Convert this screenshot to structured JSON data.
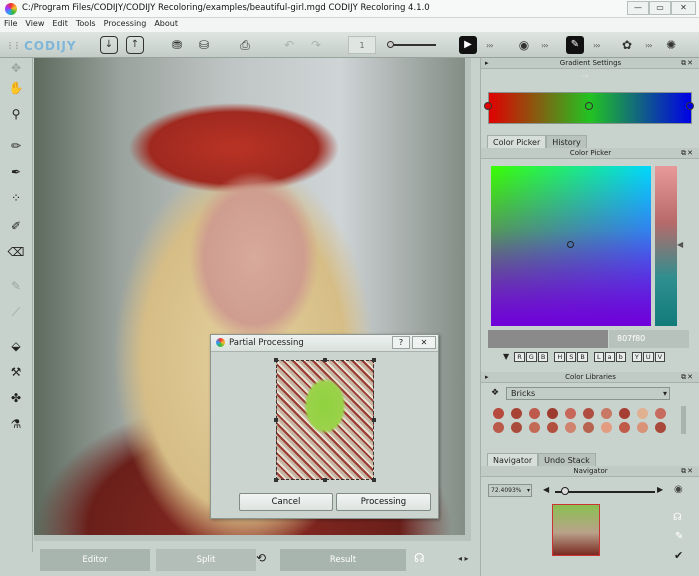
{
  "window": {
    "title": "C:/Program Files/CODIJY/CODIJY Recoloring/examples/beautiful-girl.mgd CODIJY Recoloring 4.1.0"
  },
  "menu": [
    "File",
    "View",
    "Edit",
    "Tools",
    "Processing",
    "About"
  ],
  "toolbar": {
    "logo": "CODIJY",
    "page_number": "1"
  },
  "panels": {
    "gradient": {
      "title": "Gradient Settings"
    },
    "picker_tabs": [
      "Color Picker",
      "History"
    ],
    "picker": {
      "title": "Color Picker",
      "hex": "807f80",
      "modes": [
        "R",
        "G",
        "B",
        "H",
        "S",
        "B",
        "L",
        "a",
        "b",
        "Y",
        "U",
        "V"
      ]
    },
    "libraries": {
      "title": "Color Libraries",
      "selected": "Bricks",
      "swatches": [
        "#b54a3d",
        "#a74335",
        "#bd5a4c",
        "#9d3b30",
        "#c7675a",
        "#b04d41",
        "#c97865",
        "#a63e33",
        "#e0b090",
        "#c76b5f",
        "#b95a4a",
        "#a94c3d",
        "#c36a57",
        "#b25040",
        "#d0846f",
        "#b8634f",
        "#e39c80",
        "#c05b4a",
        "#d89379",
        "#a8493b"
      ]
    },
    "nav_tabs": [
      "Navigator",
      "Undo Stack"
    ],
    "navigator": {
      "title": "Navigator",
      "zoom": "72.4093%"
    }
  },
  "bottom_tabs": [
    "Editor",
    "Split",
    "Result"
  ],
  "dialog": {
    "title": "Partial Processing",
    "cancel": "Cancel",
    "processing": "Processing",
    "help": "?",
    "close": "✕"
  },
  "colors": {
    "accent": "#2f6fd8",
    "tab_bg": "#a8b4ae"
  }
}
